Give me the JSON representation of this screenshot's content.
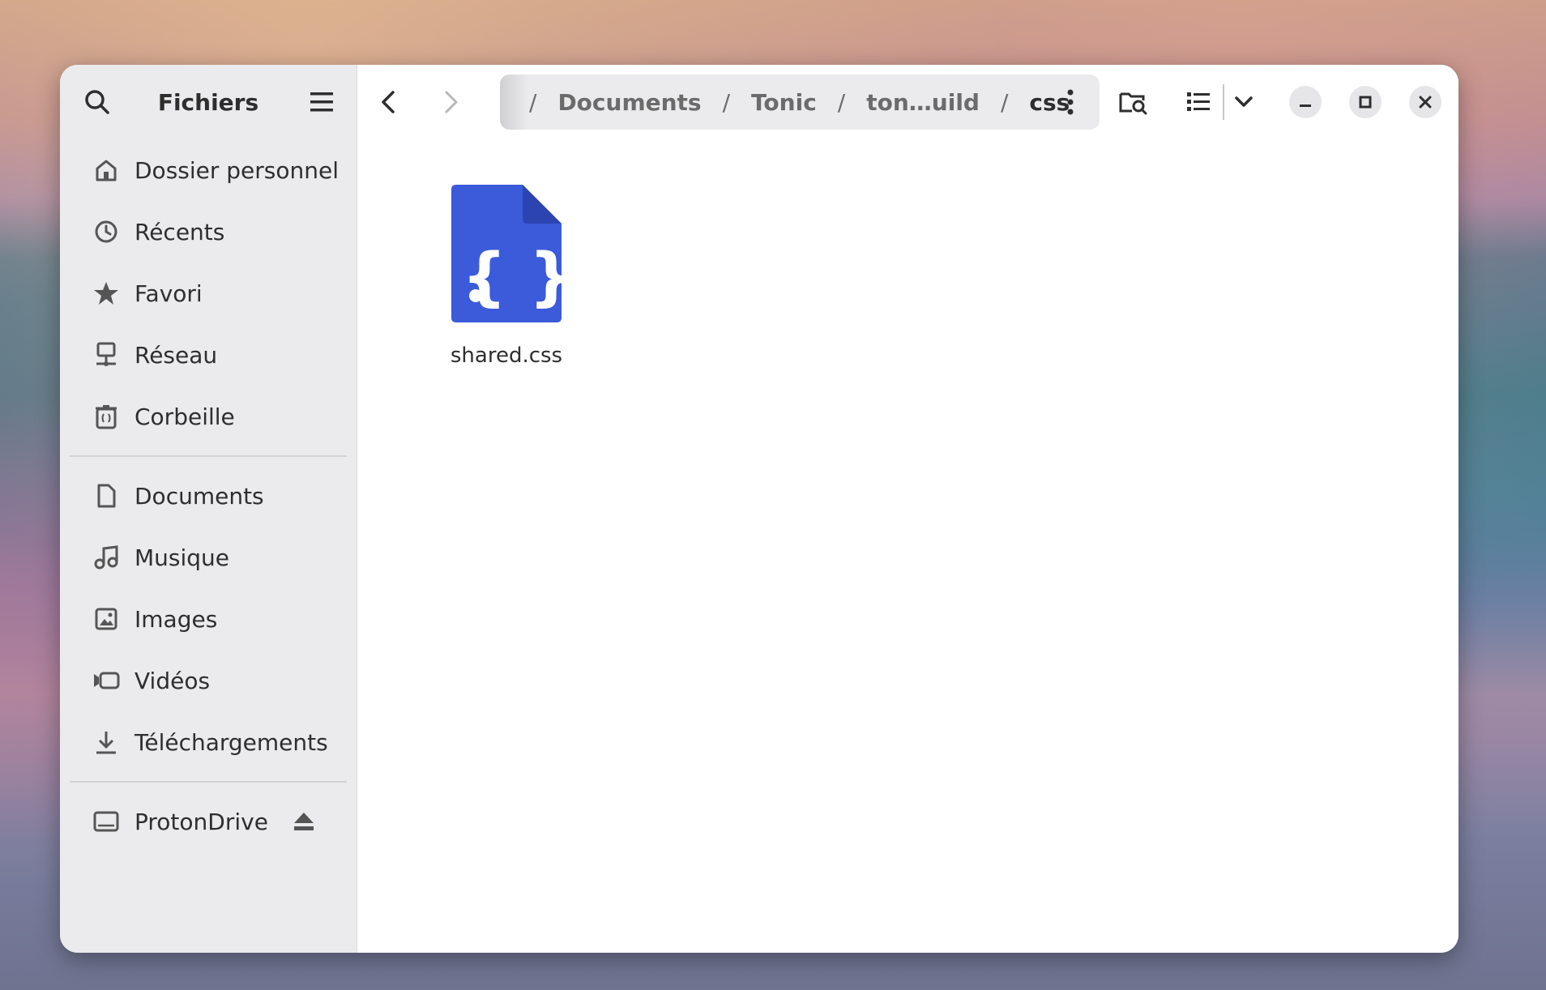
{
  "app": {
    "title": "Fichiers"
  },
  "sidebar": {
    "places": [
      {
        "label": "Dossier personnel",
        "icon": "home-icon"
      },
      {
        "label": "Récents",
        "icon": "clock-icon"
      },
      {
        "label": "Favori",
        "icon": "star-icon"
      },
      {
        "label": "Réseau",
        "icon": "network-icon"
      },
      {
        "label": "Corbeille",
        "icon": "trash-icon"
      }
    ],
    "bookmarks": [
      {
        "label": "Documents",
        "icon": "document-icon"
      },
      {
        "label": "Musique",
        "icon": "music-icon"
      },
      {
        "label": "Images",
        "icon": "image-icon"
      },
      {
        "label": "Vidéos",
        "icon": "video-icon"
      },
      {
        "label": "Téléchargements",
        "icon": "download-icon"
      }
    ],
    "devices": [
      {
        "label": "ProtonDrive",
        "icon": "drive-icon"
      }
    ]
  },
  "pathbar": {
    "segments": [
      "Documents",
      "Tonic",
      "ton…uild",
      "css"
    ],
    "root": "/"
  },
  "files": [
    {
      "name": "shared.css",
      "icon": "css-file-icon",
      "color": "#3b5bdb"
    }
  ],
  "colors": {
    "accent": "#3b5bdb",
    "sidebar_bg": "#ebebed"
  }
}
